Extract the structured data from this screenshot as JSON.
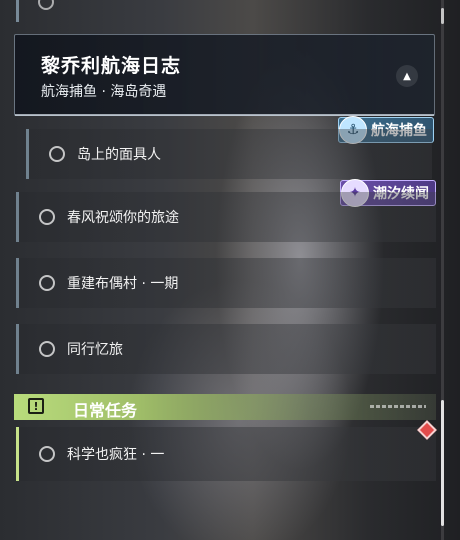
{
  "quest_group": {
    "title": "黎乔利航海日志",
    "subtitle": "航海捕鱼 · 海岛奇遇",
    "collapse_icon": "chevron-up-icon"
  },
  "tags": {
    "fishing": {
      "label": "航海捕鱼",
      "color": "#2e5470"
    },
    "tide": {
      "label": "潮汐续闻",
      "color": "#4e3a85"
    }
  },
  "quests": [
    {
      "label": "岛上的面具人"
    },
    {
      "label": "春风祝颂你的旅途"
    },
    {
      "label": "重建布偶村 · 一期"
    },
    {
      "label": "同行忆旅"
    }
  ],
  "daily_section": {
    "title": "日常任务",
    "icon": "alert-icon",
    "accent": "#b9dc7c",
    "quests": [
      {
        "label": "科学也疯狂 · 一"
      }
    ]
  },
  "marker_color": "#e24b4b"
}
